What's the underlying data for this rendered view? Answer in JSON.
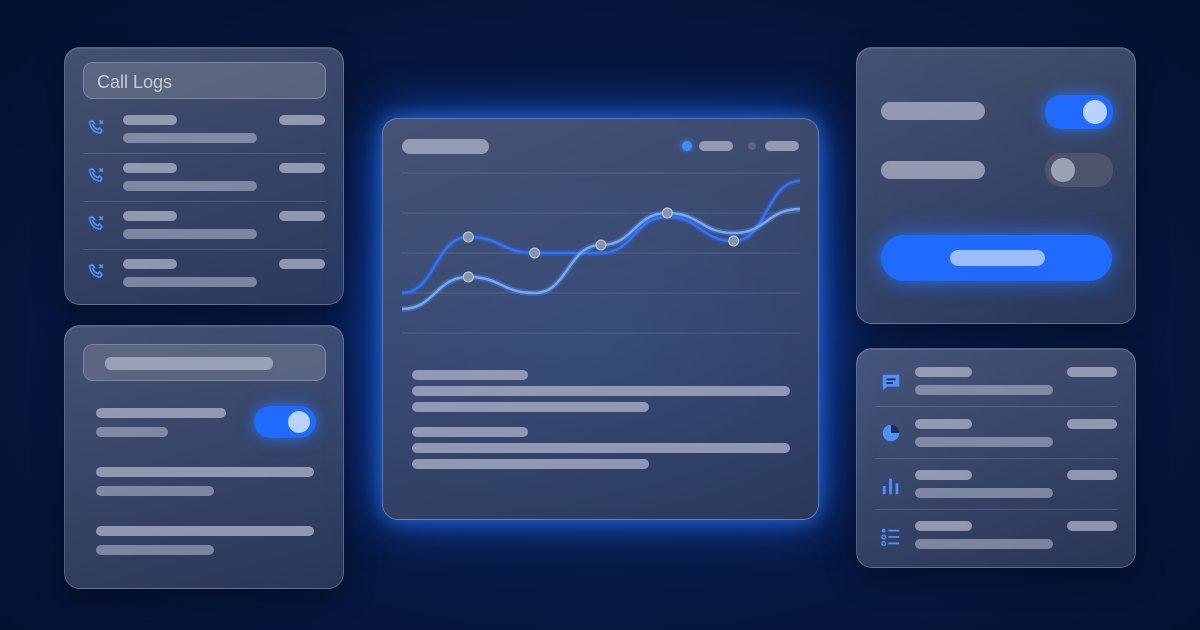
{
  "call_logs": {
    "title": "Call Logs",
    "rows": [
      {
        "icon": "missed-call-icon"
      },
      {
        "icon": "missed-call-icon"
      },
      {
        "icon": "missed-call-icon"
      },
      {
        "icon": "missed-call-icon"
      }
    ]
  },
  "settings": {
    "toggle_on": true
  },
  "chart": {
    "series_colors": [
      "#2f74ff",
      "#6ea8ff"
    ],
    "legend_active_color": "#3f8cff"
  },
  "toggles_panel": {
    "toggle_1_on": true,
    "toggle_2_on": false
  },
  "list_panel": {
    "icons": [
      "chat-icon",
      "pie-chart-icon",
      "bar-chart-icon",
      "checklist-icon"
    ]
  },
  "colors": {
    "accent": "#1f6bff",
    "background": "#04102e"
  },
  "chart_data": {
    "type": "line",
    "x": [
      0,
      1,
      2,
      3,
      4,
      5,
      6
    ],
    "series": [
      {
        "values": [
          1.0,
          2.4,
          2.0,
          2.0,
          2.9,
          2.3,
          3.8
        ]
      },
      {
        "values": [
          0.6,
          1.4,
          1.0,
          2.2,
          3.0,
          2.5,
          3.1
        ]
      }
    ],
    "ylim": [
      0,
      4
    ],
    "grid": true
  }
}
